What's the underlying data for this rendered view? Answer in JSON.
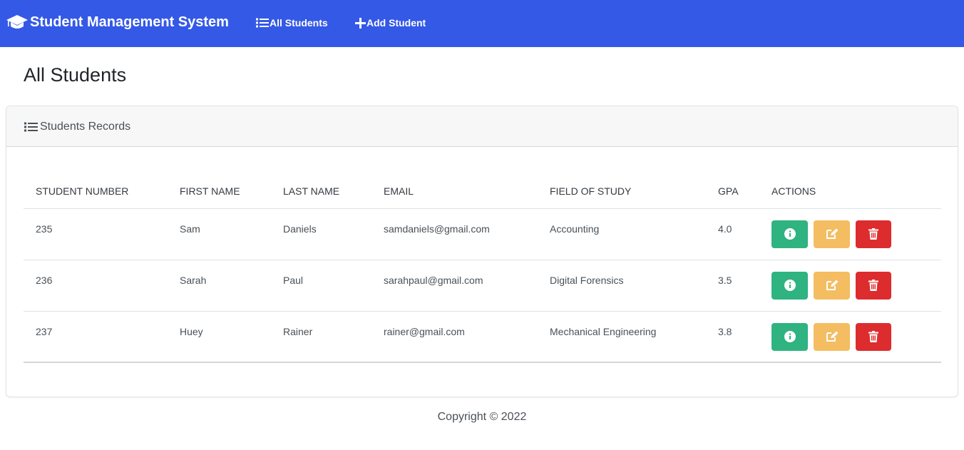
{
  "navbar": {
    "brand": "Student Management System",
    "brand_icon": "graduation-cap-icon",
    "links": [
      {
        "label": "All Students",
        "icon": "list-icon"
      },
      {
        "label": "Add Student",
        "icon": "plus-icon"
      }
    ],
    "color": "#3459e6"
  },
  "page": {
    "title": "All Students"
  },
  "card": {
    "header": "Students Records",
    "header_icon": "list-icon"
  },
  "table": {
    "columns": [
      "STUDENT NUMBER",
      "FIRST NAME",
      "LAST NAME",
      "EMAIL",
      "FIELD OF STUDY",
      "GPA",
      "ACTIONS"
    ],
    "rows": [
      {
        "number": "235",
        "first": "Sam",
        "last": "Daniels",
        "email": "samdaniels@gmail.com",
        "field": "Accounting",
        "gpa": "4.0"
      },
      {
        "number": "236",
        "first": "Sarah",
        "last": "Paul",
        "email": "sarahpaul@gmail.com",
        "field": "Digital Forensics",
        "gpa": "3.5"
      },
      {
        "number": "237",
        "first": "Huey",
        "last": "Rainer",
        "email": "rainer@gmail.com",
        "field": "Mechanical Engineering",
        "gpa": "3.8"
      }
    ],
    "action_icons": [
      "info-icon",
      "edit-icon",
      "trash-icon"
    ],
    "action_colors": {
      "info": "#2fb380",
      "edit": "#f4bd61",
      "delete": "#dd2c2d"
    }
  },
  "footer": {
    "text": "Copyright © 2022"
  }
}
